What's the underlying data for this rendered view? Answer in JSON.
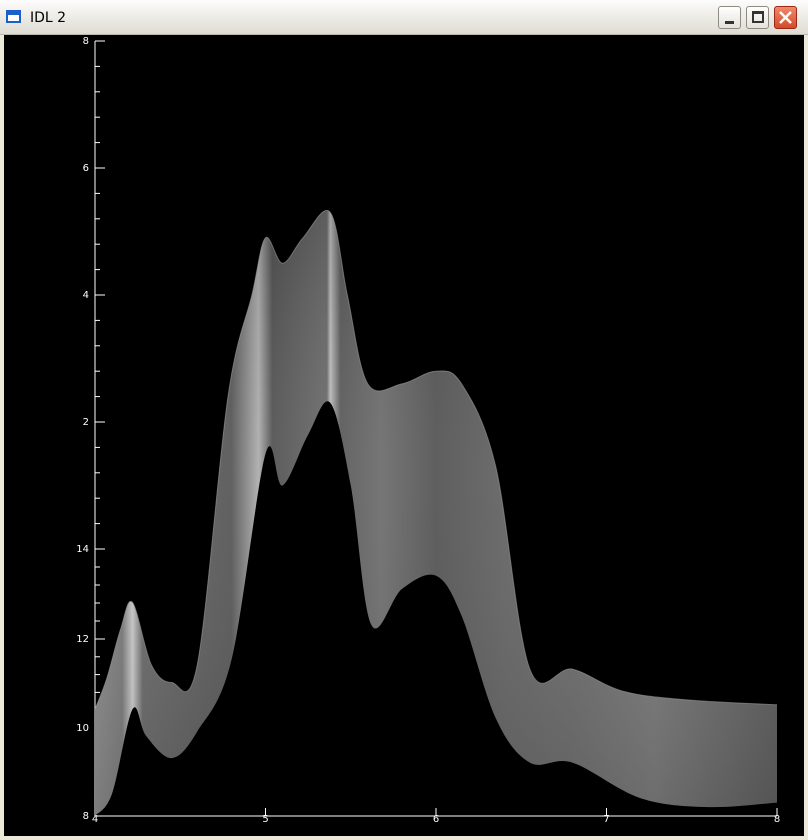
{
  "window": {
    "title": "IDL 2"
  },
  "icons": {
    "app": "idl-window-icon",
    "minimize": "minimize-icon",
    "maximize": "maximize-icon",
    "close": "close-icon"
  },
  "colors": {
    "plot_background": "#000000",
    "axis": "#ffffff",
    "surface_base": "#5a5a5a",
    "close_button": "#d24a2b"
  },
  "chart_data": {
    "type": "area",
    "title": "",
    "xlabel": "",
    "ylabel": "",
    "grid": false,
    "x_tick_labels": [
      "4",
      "5",
      "6",
      "7",
      "8"
    ],
    "y_tick_labels": [
      "8",
      "10",
      "12",
      "14",
      "2",
      "4",
      "6",
      "8"
    ],
    "x_range": [
      4,
      8
    ],
    "upper_edge": [
      {
        "x": 4.0,
        "y": 10.4
      },
      {
        "x": 4.07,
        "y": 11.1
      },
      {
        "x": 4.15,
        "y": 12.2
      },
      {
        "x": 4.22,
        "y": 12.8
      },
      {
        "x": 4.33,
        "y": 11.4
      },
      {
        "x": 4.45,
        "y": 11.0
      },
      {
        "x": 4.6,
        "y": 11.4
      },
      {
        "x": 4.78,
        "y": 2.4
      },
      {
        "x": 4.92,
        "y": 4.0
      },
      {
        "x": 5.0,
        "y": 4.9
      },
      {
        "x": 5.1,
        "y": 4.5
      },
      {
        "x": 5.22,
        "y": 4.9
      },
      {
        "x": 5.38,
        "y": 5.3
      },
      {
        "x": 5.48,
        "y": 4.0
      },
      {
        "x": 5.6,
        "y": 2.6
      },
      {
        "x": 5.8,
        "y": 2.6
      },
      {
        "x": 6.0,
        "y": 2.8
      },
      {
        "x": 6.15,
        "y": 2.6
      },
      {
        "x": 6.35,
        "y": 1.3
      },
      {
        "x": 6.55,
        "y": 11.3
      },
      {
        "x": 6.8,
        "y": 11.3
      },
      {
        "x": 7.1,
        "y": 10.8
      },
      {
        "x": 7.5,
        "y": 10.6
      },
      {
        "x": 8.0,
        "y": 10.5
      }
    ],
    "lower_edge": [
      {
        "x": 4.0,
        "y": 8.0
      },
      {
        "x": 4.1,
        "y": 8.5
      },
      {
        "x": 4.22,
        "y": 10.4
      },
      {
        "x": 4.3,
        "y": 9.8
      },
      {
        "x": 4.45,
        "y": 9.3
      },
      {
        "x": 4.6,
        "y": 9.9
      },
      {
        "x": 4.8,
        "y": 11.5
      },
      {
        "x": 5.0,
        "y": 1.5
      },
      {
        "x": 5.1,
        "y": 1.0
      },
      {
        "x": 5.25,
        "y": 1.8
      },
      {
        "x": 5.38,
        "y": 2.3
      },
      {
        "x": 5.5,
        "y": 1.0
      },
      {
        "x": 5.62,
        "y": 12.3
      },
      {
        "x": 5.8,
        "y": 13.1
      },
      {
        "x": 6.0,
        "y": 13.4
      },
      {
        "x": 6.15,
        "y": 12.5
      },
      {
        "x": 6.35,
        "y": 10.2
      },
      {
        "x": 6.55,
        "y": 9.2
      },
      {
        "x": 6.8,
        "y": 9.2
      },
      {
        "x": 7.2,
        "y": 8.4
      },
      {
        "x": 7.6,
        "y": 8.2
      },
      {
        "x": 8.0,
        "y": 8.3
      }
    ]
  }
}
